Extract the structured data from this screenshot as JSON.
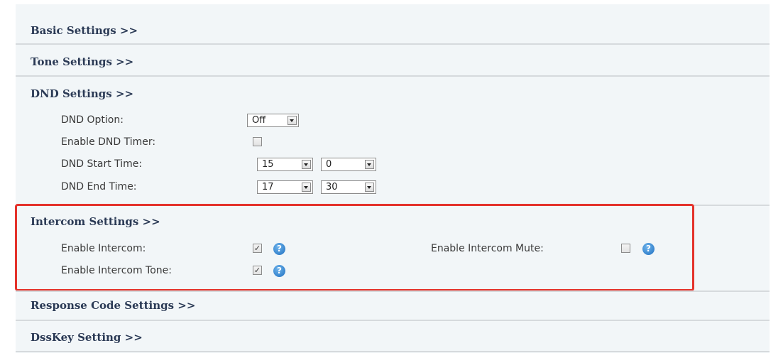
{
  "sections": {
    "basic": "Basic Settings >>",
    "tone": "Tone Settings >>",
    "dnd": "DND Settings >>",
    "intercom": "Intercom Settings >>",
    "response": "Response Code Settings >>",
    "dsskey": "DssKey Setting >>"
  },
  "dnd": {
    "option_label": "DND Option:",
    "option_value": "Off",
    "timer_label": "Enable DND Timer:",
    "timer_checked": false,
    "start_label": "DND Start Time:",
    "start_hour": "15",
    "start_min": "0",
    "end_label": "DND End Time:",
    "end_hour": "17",
    "end_min": "30"
  },
  "intercom": {
    "enable_label": "Enable Intercom:",
    "enable_checked": true,
    "mute_label": "Enable Intercom Mute:",
    "mute_checked": false,
    "tone_label": "Enable Intercom Tone:",
    "tone_checked": true
  },
  "icons": {
    "help": "help-icon",
    "check": "✓"
  },
  "colors": {
    "highlight": "#e4322b",
    "section_title": "#2b3a55",
    "help_icon": "#1f6fc0"
  }
}
